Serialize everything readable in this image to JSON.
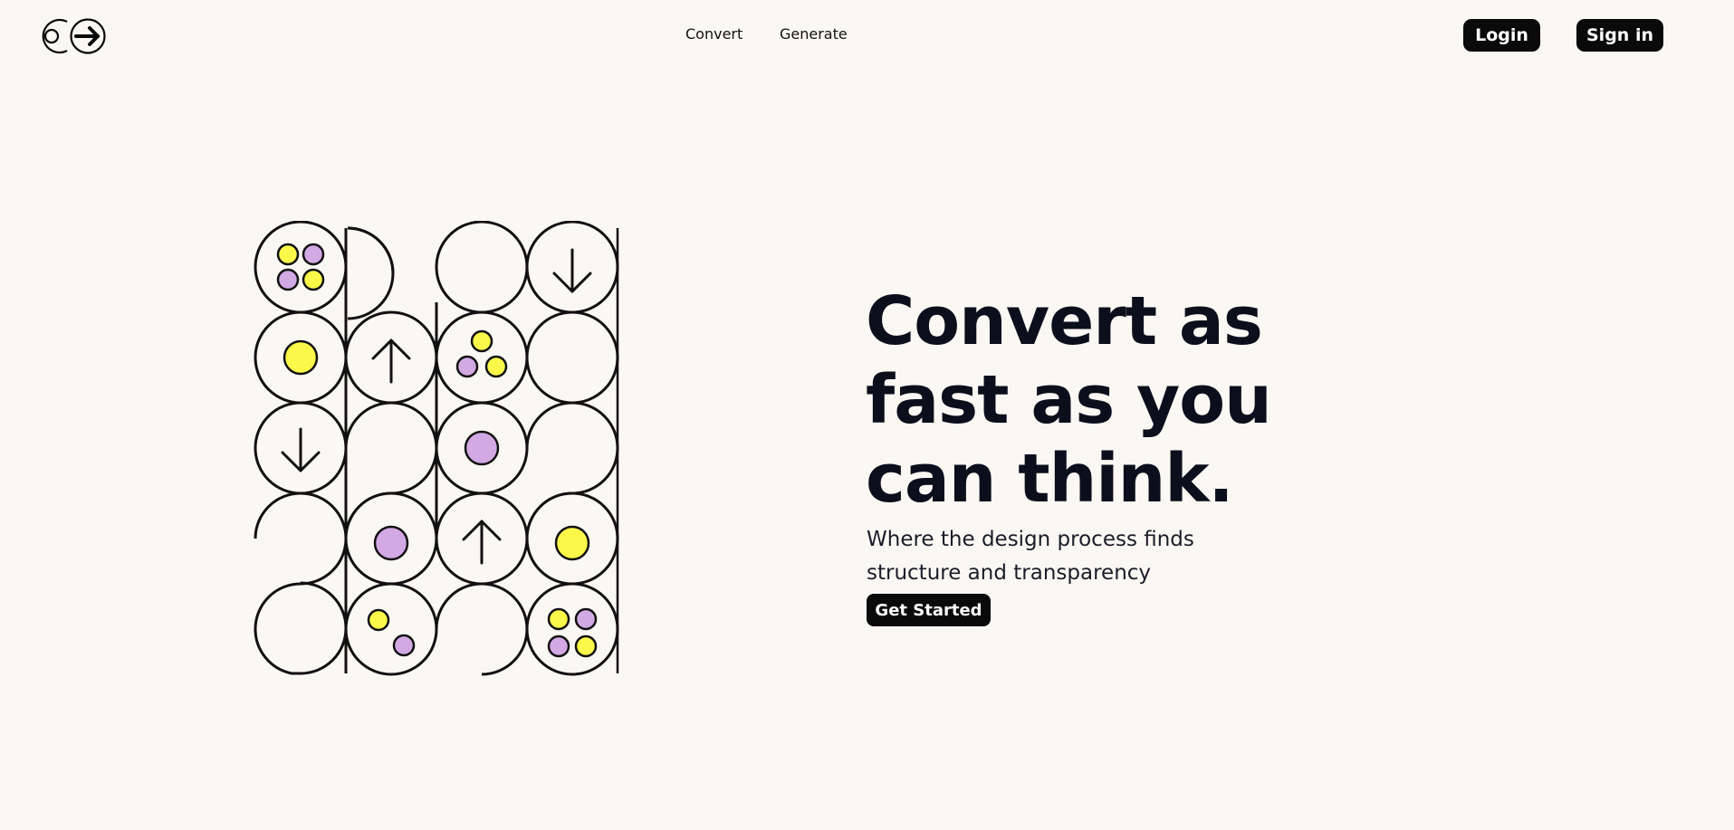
{
  "nav": {
    "links": [
      "Convert",
      "Generate"
    ],
    "login_label": "Login",
    "signin_label": "Sign in"
  },
  "hero": {
    "headline_lines": [
      "Convert as",
      "fast as you",
      "can think."
    ],
    "subtitle": "Where the design process finds structure and transparency",
    "cta_label": "Get Started"
  },
  "colors": {
    "background": "#fbf7f3",
    "button": "#0a0a0a",
    "accent_yellow": "#fbf84a",
    "accent_purple": "#d3a9e4"
  }
}
